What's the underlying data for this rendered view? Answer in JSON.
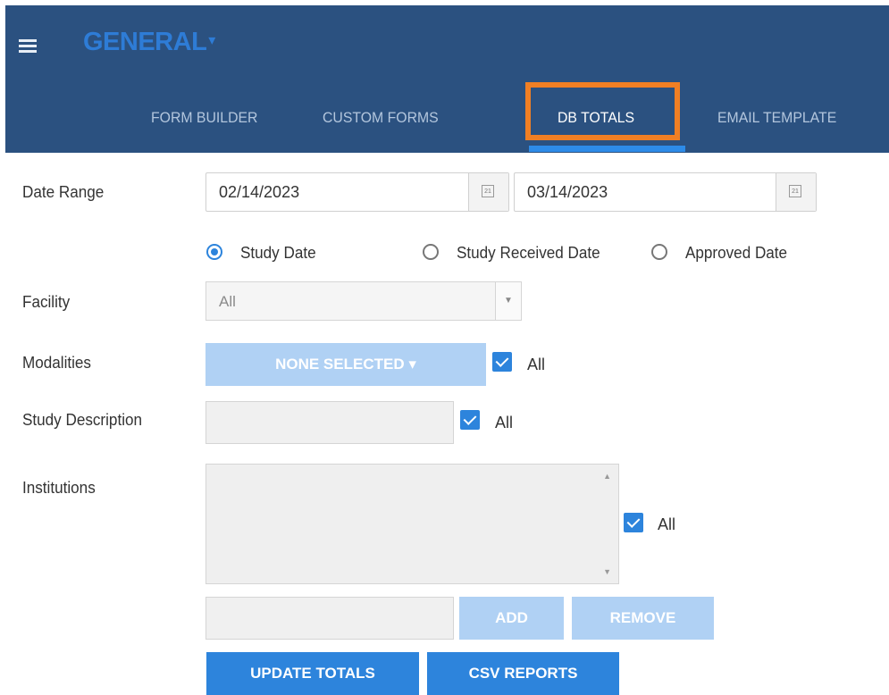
{
  "header": {
    "brand": "GENERAL",
    "brand_caret": "▾",
    "tabs": [
      {
        "label": "FORM BUILDER"
      },
      {
        "label": "CUSTOM FORMS"
      },
      {
        "label": "DB TOTALS",
        "active": true
      },
      {
        "label": "EMAIL TEMPLATE"
      }
    ]
  },
  "form": {
    "date_range": {
      "label": "Date Range",
      "start": "02/14/2023",
      "end": "03/14/2023",
      "calendar_icon_text": "21"
    },
    "date_type": {
      "options": [
        "Study Date",
        "Study Received Date",
        "Approved Date"
      ],
      "selected": "Study Date"
    },
    "facility": {
      "label": "Facility",
      "value": "All",
      "arrow": "▼"
    },
    "modalities": {
      "label": "Modalities",
      "button": "NONE SELECTED",
      "caret": "▾",
      "all_label": "All",
      "all_checked": true
    },
    "study_description": {
      "label": "Study Description",
      "value": "",
      "all_label": "All",
      "all_checked": true
    },
    "institutions": {
      "label": "Institutions",
      "all_label": "All",
      "all_checked": true,
      "scroll_up": "▲",
      "scroll_down": "▼",
      "add_label": "ADD",
      "remove_label": "REMOVE"
    },
    "actions": {
      "update_label": "UPDATE TOTALS",
      "csv_label": "CSV REPORTS"
    }
  },
  "colors": {
    "header_bg": "#2b5180",
    "accent": "#2d84dc",
    "highlight": "#f07f24",
    "disabled": "#b0d1f4"
  }
}
